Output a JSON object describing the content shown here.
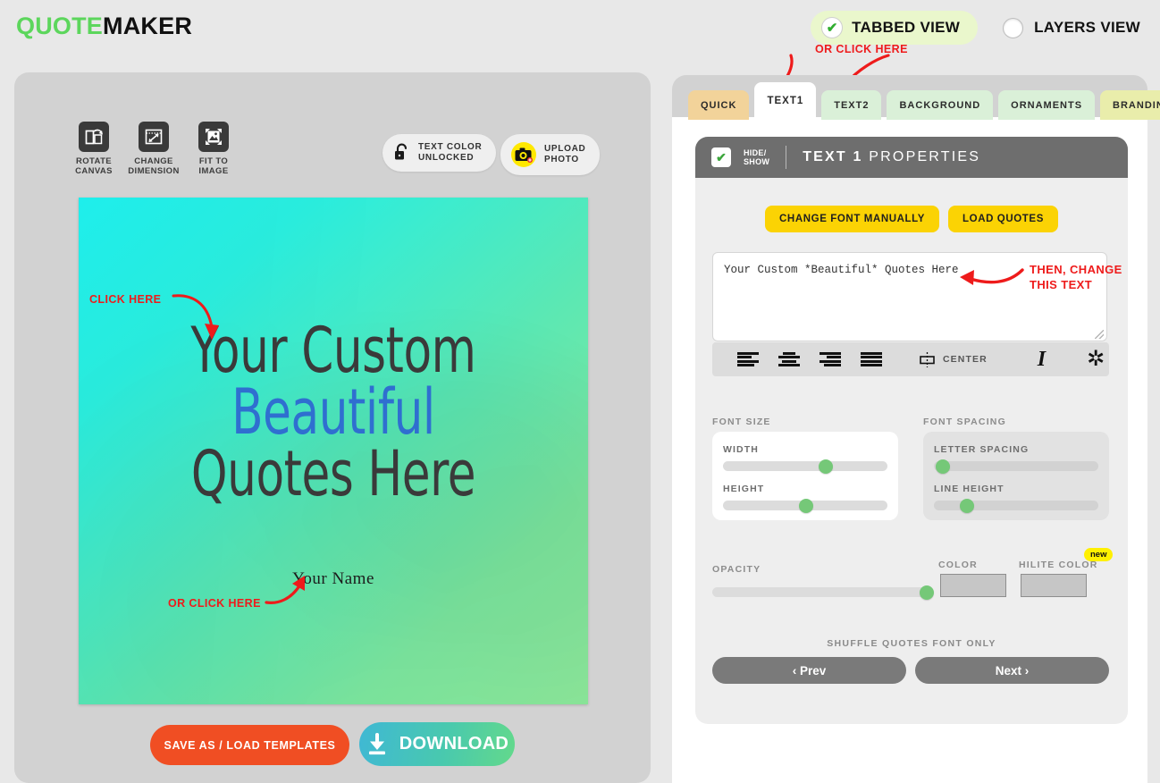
{
  "app": {
    "title_part1": "QUOTE",
    "title_part2": "MAKER",
    "brand_color": "#5cd65c"
  },
  "header": {
    "tabbed_view_label": "TABBED VIEW",
    "layers_view_label": "LAYERS VIEW",
    "hint_or_click_here": "OR CLICK HERE"
  },
  "canvas_toolbar": {
    "tools": [
      {
        "caption_line1": "ROTATE",
        "caption_line2": "CANVAS",
        "icon": "rotate-canvas-icon"
      },
      {
        "caption_line1": "CHANGE",
        "caption_line2": "DIMENSION",
        "icon": "change-dimension-icon"
      },
      {
        "caption_line1": "FIT TO",
        "caption_line2": "IMAGE",
        "icon": "fit-to-image-icon"
      }
    ],
    "text_color_line1": "TEXT COLOR",
    "text_color_line2": "UNLOCKED",
    "upload_line1": "UPLOAD",
    "upload_line2": "PHOTO"
  },
  "canvas": {
    "line1": "Your Custom",
    "line2": "Beautiful",
    "line3": "Quotes Here",
    "highlight_color": "#2f6fd0",
    "text_color": "#3a3a3a",
    "signature": "Your Name",
    "gradient_from": "#1ff1ef",
    "gradient_to": "#8ce79a",
    "hint_click_here": "CLICK HERE",
    "hint_or_click_here": "OR CLICK HERE"
  },
  "actions": {
    "save_label": "SAVE AS / LOAD TEMPLATES",
    "download_label": "DOWNLOAD"
  },
  "tabs": [
    {
      "label": "QUICK",
      "state": "quick"
    },
    {
      "label": "TEXT1",
      "state": "active"
    },
    {
      "label": "TEXT2",
      "state": "green"
    },
    {
      "label": "BACKGROUND",
      "state": "green"
    },
    {
      "label": "ORNAMENTS",
      "state": "green"
    },
    {
      "label": "BRANDING",
      "state": "brand"
    }
  ],
  "properties_panel": {
    "hide_show_line1": "HIDE/",
    "hide_show_line2": "SHOW",
    "title_bold": "TEXT 1",
    "title_light": "PROPERTIES",
    "change_font_label": "CHANGE FONT MANUALLY",
    "load_quotes_label": "LOAD QUOTES",
    "textarea_value": "Your Custom *Beautiful* Quotes Here",
    "hint_then_change_line1": "THEN, CHANGE",
    "hint_then_change_line2": "THIS TEXT",
    "align_options": [
      "align-left",
      "align-center",
      "align-right",
      "align-justify"
    ],
    "vertical_align_label": "CENTER",
    "italic_label": "I",
    "asterisk_label": "✲",
    "font_size_label": "FONT SIZE",
    "font_spacing_label": "FONT SPACING",
    "width_label": "WIDTH",
    "height_label": "HEIGHT",
    "letter_spacing_label": "LETTER SPACING",
    "line_height_label": "LINE HEIGHT",
    "opacity_label": "OPACITY",
    "color_label": "COLOR",
    "hilite_color_label": "HILITE COLOR",
    "new_badge": "new",
    "shuffle_label": "SHUFFLE QUOTES FONT ONLY",
    "prev_label": "‹ Prev",
    "next_label": "Next ›",
    "slider_values": {
      "width_pct": 58,
      "height_pct": 46,
      "letter_spacing_pct": 3,
      "line_height_pct": 17,
      "opacity_pct": 97
    },
    "swatch_color": "#c6c6c6"
  }
}
